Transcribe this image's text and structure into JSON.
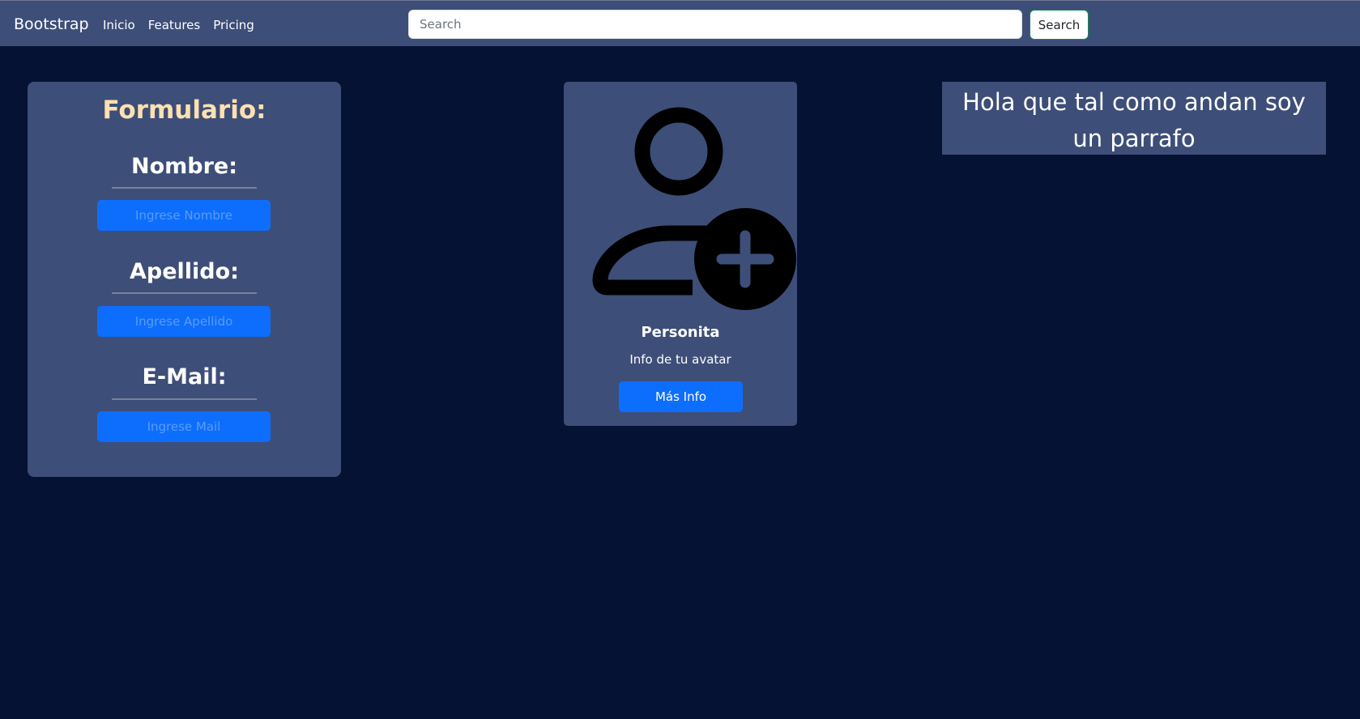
{
  "navbar": {
    "brand": "Bootstrap",
    "links": [
      "Inicio",
      "Features",
      "Pricing"
    ],
    "search_placeholder": "Search",
    "search_button": "Search"
  },
  "form": {
    "title": "Formulario:",
    "fields": [
      {
        "label": "Nombre:",
        "placeholder": "Ingrese Nombre"
      },
      {
        "label": "Apellido:",
        "placeholder": "Ingrese Apellido"
      },
      {
        "label": "E-Mail:",
        "placeholder": "Ingrese Mail"
      }
    ]
  },
  "avatar_card": {
    "icon": "person-add-icon",
    "name": "Personita",
    "info": "Info de tu avatar",
    "button": "Más Info"
  },
  "paragraph": {
    "text": "Hola que tal como andan soy un parrafo"
  },
  "colors": {
    "page_bg": "#051233",
    "navbar_bg": "#3d4e78",
    "card_bg": "#3d4e78",
    "form_title": "#ffe0b0",
    "primary": "#0d6efd",
    "search_button_border": "#198754"
  }
}
